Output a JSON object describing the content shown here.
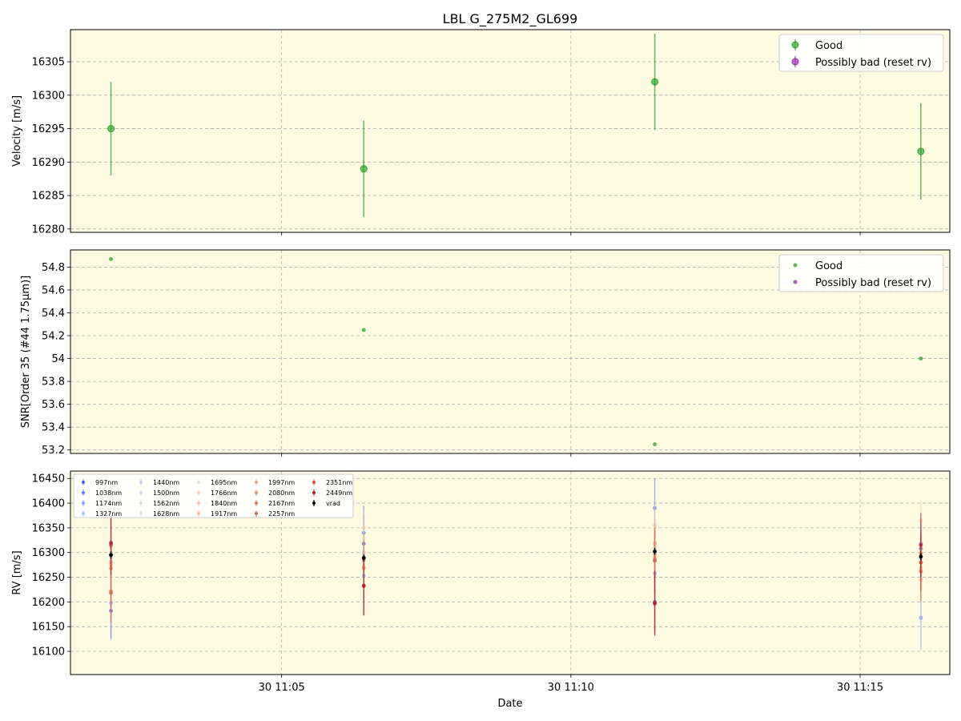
{
  "chart_data": {
    "title": "LBL G_275M2_GL699",
    "type": "scatter",
    "shared_x_ticks": [
      "30 11:05",
      "30 11:10",
      "30 11:15"
    ],
    "x_ticks_minutes": [
      5,
      10,
      15
    ],
    "x_range_minutes": [
      1.35,
      16.55
    ],
    "xlabel": "Date",
    "background_color": "#fdfbe2",
    "grid": true,
    "panels": [
      {
        "ylabel": "Velocity [m/s]",
        "ylim": [
          16279.5,
          16309.8
        ],
        "yticks": [
          16280,
          16285,
          16290,
          16295,
          16300,
          16305
        ],
        "legend": {
          "placement": "top-right",
          "entries": [
            {
              "label": "Good",
              "color": "#2ca02c"
            },
            {
              "label": "Possibly bad (reset rv)",
              "color": "#9c27b0"
            }
          ]
        },
        "series": [
          {
            "name": "Good",
            "color": "#2ca02c",
            "points": [
              {
                "x": 2.05,
                "y": 16295.0,
                "err": 7.0
              },
              {
                "x": 6.42,
                "y": 16289.0,
                "err": 7.2
              },
              {
                "x": 11.45,
                "y": 16302.0,
                "err": 7.2
              },
              {
                "x": 16.05,
                "y": 16291.6,
                "err": 7.2
              }
            ]
          },
          {
            "name": "Possibly bad (reset rv)",
            "color": "#9c27b0",
            "points": []
          }
        ]
      },
      {
        "ylabel": "SNR[Order 35 (#44 1.75μm)]",
        "ylim": [
          53.17,
          54.95
        ],
        "yticks": [
          53.2,
          53.4,
          53.6,
          53.8,
          54.0,
          54.2,
          54.4,
          54.6,
          54.8
        ],
        "legend": {
          "placement": "top-right",
          "entries": [
            {
              "label": "Good",
              "color": "#2ca02c"
            },
            {
              "label": "Possibly bad (reset rv)",
              "color": "#9c27b0"
            }
          ]
        },
        "series": [
          {
            "name": "Good",
            "color": "#2ca02c",
            "points": [
              {
                "x": 2.05,
                "y": 54.87
              },
              {
                "x": 6.42,
                "y": 54.25
              },
              {
                "x": 11.45,
                "y": 53.25
              },
              {
                "x": 16.05,
                "y": 54.0
              }
            ]
          },
          {
            "name": "Possibly bad (reset rv)",
            "color": "#9c27b0",
            "points": []
          }
        ]
      },
      {
        "ylabel": "RV [m/s]",
        "ylim": [
          16053,
          16465
        ],
        "yticks": [
          16100,
          16150,
          16200,
          16250,
          16300,
          16350,
          16400,
          16450
        ],
        "legend": {
          "placement": "top-left",
          "columns": 5
        },
        "epochs_x": [
          2.05,
          6.42,
          11.45,
          16.05
        ],
        "series": [
          {
            "name": "997nm",
            "color": "#4a63d4",
            "values": [
              16182,
              16318,
              16200,
              16308
            ],
            "errs": [
              55,
              60,
              60,
              55
            ]
          },
          {
            "name": "1038nm",
            "color": "#6280e6",
            "values": [
              16318,
              16340,
              16390,
              16318
            ],
            "errs": [
              50,
              55,
              60,
              50
            ]
          },
          {
            "name": "1174nm",
            "color": "#8ba5f5",
            "values": [
              16198,
              16253,
              16258,
              16168
            ],
            "errs": [
              75,
              65,
              75,
              65
            ]
          },
          {
            "name": "1327nm",
            "color": "#a9c0fb",
            "values": [
              16282,
              16300,
              16303,
              16293
            ],
            "errs": [
              50,
              45,
              55,
              45
            ]
          },
          {
            "name": "1440nm",
            "color": "#bcd0f7",
            "values": [
              16282,
              16290,
              16308,
              16297
            ],
            "errs": [
              40,
              40,
              45,
              40
            ]
          },
          {
            "name": "1500nm",
            "color": "#c8d7f2",
            "values": [
              16290,
              16295,
              16300,
              16287
            ],
            "errs": [
              35,
              35,
              40,
              35
            ]
          },
          {
            "name": "1562nm",
            "color": "#d3dbe8",
            "values": [
              16300,
              16290,
              16310,
              16293
            ],
            "errs": [
              30,
              30,
              35,
              30
            ]
          },
          {
            "name": "1628nm",
            "color": "#dde0e4",
            "values": [
              16285,
              16285,
              16298,
              16290
            ],
            "errs": [
              35,
              35,
              40,
              35
            ]
          },
          {
            "name": "1695nm",
            "color": "#e7dcd3",
            "values": [
              16295,
              16278,
              16305,
              16295
            ],
            "errs": [
              35,
              40,
              40,
              35
            ]
          },
          {
            "name": "1766nm",
            "color": "#efd5c5",
            "values": [
              16310,
              16302,
              16320,
              16302
            ],
            "errs": [
              40,
              40,
              45,
              40
            ]
          },
          {
            "name": "1840nm",
            "color": "#f4c8b2",
            "values": [
              16300,
              16350,
              16355,
              16365
            ],
            "errs": [
              40,
              35,
              40,
              40
            ]
          },
          {
            "name": "1917nm",
            "color": "#f5b89c",
            "values": [
              16275,
              16272,
              16295,
              16245
            ],
            "errs": [
              45,
              45,
              50,
              45
            ]
          },
          {
            "name": "1997nm",
            "color": "#f2a586",
            "values": [
              16280,
              16285,
              16318,
              16268
            ],
            "errs": [
              45,
              45,
              50,
              45
            ]
          },
          {
            "name": "2080nm",
            "color": "#eb8f70",
            "values": [
              16268,
              16290,
              16290,
              16280
            ],
            "errs": [
              50,
              50,
              55,
              50
            ]
          },
          {
            "name": "2167nm",
            "color": "#e07a5b",
            "values": [
              16222,
              16268,
              16283,
              16298
            ],
            "errs": [
              55,
              55,
              60,
              55
            ]
          },
          {
            "name": "2257nm",
            "color": "#d26349",
            "values": [
              16218,
              16232,
              16285,
              16262
            ],
            "errs": [
              60,
              60,
              65,
              60
            ]
          },
          {
            "name": "2351nm",
            "color": "#c14a39",
            "values": [
              16315,
              16233,
              16196,
              16280
            ],
            "errs": [
              60,
              60,
              65,
              60
            ]
          },
          {
            "name": "2449nm",
            "color": "#b2182b",
            "values": [
              16320,
              16233,
              16198,
              16315
            ],
            "errs": [
              65,
              60,
              65,
              65
            ]
          },
          {
            "name": "vrad",
            "color": "#000000",
            "values": [
              16295,
              16289,
              16302,
              16291.6
            ],
            "errs": [
              7,
              7.2,
              7.2,
              7.2
            ]
          }
        ]
      }
    ]
  }
}
